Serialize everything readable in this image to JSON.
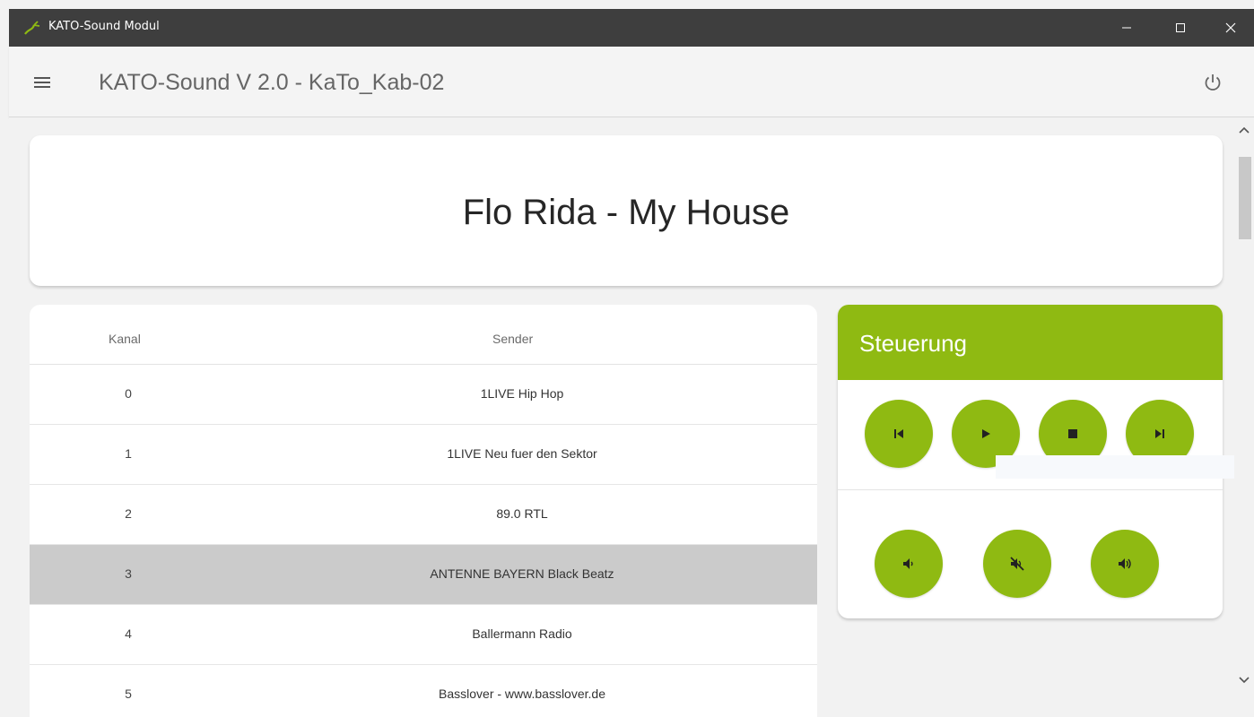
{
  "window": {
    "title": "KATO-Sound Modul",
    "controls": {
      "minimize_icon": "minimize-icon",
      "maximize_icon": "maximize-icon",
      "close_icon": "close-icon"
    }
  },
  "header": {
    "title": "KATO-Sound V 2.0 - KaTo_Kab-02",
    "menu_icon": "hamburger-menu-icon",
    "power_icon": "power-icon"
  },
  "now_playing": {
    "title": "Flo Rida - My House"
  },
  "channels": {
    "headers": {
      "kanal": "Kanal",
      "sender": "Sender"
    },
    "rows": [
      {
        "kanal": "0",
        "sender": "1LIVE Hip Hop",
        "selected": false
      },
      {
        "kanal": "1",
        "sender": "1LIVE Neu fuer den Sektor",
        "selected": false
      },
      {
        "kanal": "2",
        "sender": "89.0 RTL",
        "selected": false
      },
      {
        "kanal": "3",
        "sender": "ANTENNE BAYERN Black Beatz",
        "selected": true
      },
      {
        "kanal": "4",
        "sender": "Ballermann Radio",
        "selected": false
      },
      {
        "kanal": "5",
        "sender": "Basslover - www.basslover.de",
        "selected": false
      }
    ]
  },
  "controls": {
    "title": "Steuerung",
    "playback": [
      "skip-previous-icon",
      "play-icon",
      "stop-icon",
      "skip-next-icon"
    ],
    "volume": [
      "volume-down-icon",
      "volume-mute-icon",
      "volume-up-icon"
    ]
  },
  "colors": {
    "accent": "#8fba12",
    "titlebar": "#3e3e3e",
    "selected_row": "#cbcbcb"
  }
}
